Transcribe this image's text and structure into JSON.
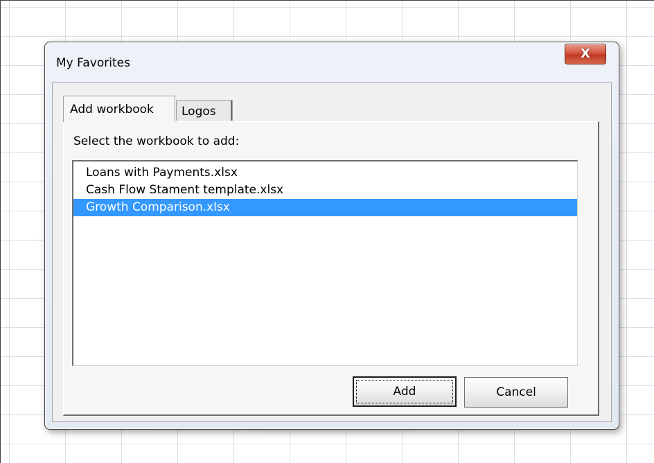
{
  "dialog": {
    "title": "My Favorites",
    "close_icon_glyph": "X"
  },
  "tabs": [
    {
      "label": "Add workbook",
      "active": true
    },
    {
      "label": "Logos",
      "active": false
    }
  ],
  "page": {
    "prompt": "Select the workbook to add:",
    "workbooks": [
      {
        "name": "Loans with Payments.xlsx",
        "selected": false
      },
      {
        "name": "Cash Flow Stament template.xlsx",
        "selected": false
      },
      {
        "name": "Growth Comparison.xlsx",
        "selected": true
      }
    ],
    "selection_color": "#3399ff"
  },
  "buttons": {
    "add": "Add",
    "cancel": "Cancel"
  }
}
